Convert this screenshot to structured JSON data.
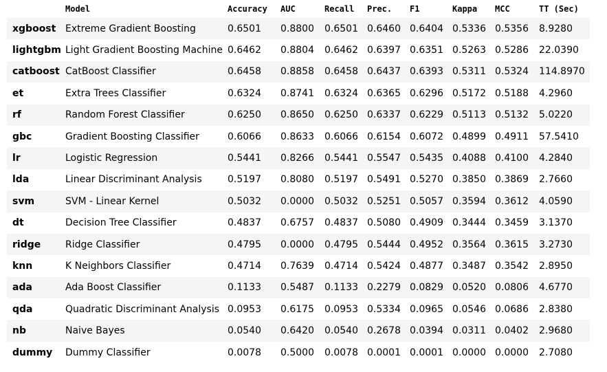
{
  "table": {
    "headers": [
      "",
      "Model",
      "Accuracy",
      "AUC",
      "Recall",
      "Prec.",
      "F1",
      "Kappa",
      "MCC",
      "TT (Sec)"
    ],
    "highlight_color": "#ffff00",
    "tt_column_color": "#d3d3d3",
    "stripe_color": "#f5f5f5",
    "rows": [
      {
        "id": "xgboost",
        "model": "Extreme Gradient Boosting",
        "values": [
          "0.6501",
          "0.8800",
          "0.6501",
          "0.6460",
          "0.6404",
          "0.5336",
          "0.5356",
          "8.9280"
        ],
        "highlighted": [
          "Accuracy",
          "Recall",
          "Prec.",
          "F1",
          "Kappa",
          "MCC"
        ]
      },
      {
        "id": "lightgbm",
        "model": "Light Gradient Boosting Machine",
        "values": [
          "0.6462",
          "0.8804",
          "0.6462",
          "0.6397",
          "0.6351",
          "0.5263",
          "0.5286",
          "22.0390"
        ],
        "highlighted": []
      },
      {
        "id": "catboost",
        "model": "CatBoost Classifier",
        "values": [
          "0.6458",
          "0.8858",
          "0.6458",
          "0.6437",
          "0.6393",
          "0.5311",
          "0.5324",
          "114.8970"
        ],
        "highlighted": [
          "AUC"
        ]
      },
      {
        "id": "et",
        "model": "Extra Trees Classifier",
        "values": [
          "0.6324",
          "0.8741",
          "0.6324",
          "0.6365",
          "0.6296",
          "0.5172",
          "0.5188",
          "4.2960"
        ],
        "highlighted": []
      },
      {
        "id": "rf",
        "model": "Random Forest Classifier",
        "values": [
          "0.6250",
          "0.8650",
          "0.6250",
          "0.6337",
          "0.6229",
          "0.5113",
          "0.5132",
          "5.0220"
        ],
        "highlighted": []
      },
      {
        "id": "gbc",
        "model": "Gradient Boosting Classifier",
        "values": [
          "0.6066",
          "0.8633",
          "0.6066",
          "0.6154",
          "0.6072",
          "0.4899",
          "0.4911",
          "57.5410"
        ],
        "highlighted": []
      },
      {
        "id": "lr",
        "model": "Logistic Regression",
        "values": [
          "0.5441",
          "0.8266",
          "0.5441",
          "0.5547",
          "0.5435",
          "0.4088",
          "0.4100",
          "4.2840"
        ],
        "highlighted": []
      },
      {
        "id": "lda",
        "model": "Linear Discriminant Analysis",
        "values": [
          "0.5197",
          "0.8080",
          "0.5197",
          "0.5491",
          "0.5270",
          "0.3850",
          "0.3869",
          "2.7660"
        ],
        "highlighted": []
      },
      {
        "id": "svm",
        "model": "SVM - Linear Kernel",
        "values": [
          "0.5032",
          "0.0000",
          "0.5032",
          "0.5251",
          "0.5057",
          "0.3594",
          "0.3612",
          "4.0590"
        ],
        "highlighted": []
      },
      {
        "id": "dt",
        "model": "Decision Tree Classifier",
        "values": [
          "0.4837",
          "0.6757",
          "0.4837",
          "0.5080",
          "0.4909",
          "0.3444",
          "0.3459",
          "3.1370"
        ],
        "highlighted": []
      },
      {
        "id": "ridge",
        "model": "Ridge Classifier",
        "values": [
          "0.4795",
          "0.0000",
          "0.4795",
          "0.5444",
          "0.4952",
          "0.3564",
          "0.3615",
          "3.2730"
        ],
        "highlighted": []
      },
      {
        "id": "knn",
        "model": "K Neighbors Classifier",
        "values": [
          "0.4714",
          "0.7639",
          "0.4714",
          "0.5424",
          "0.4877",
          "0.3487",
          "0.3542",
          "2.8950"
        ],
        "highlighted": []
      },
      {
        "id": "ada",
        "model": "Ada Boost Classifier",
        "values": [
          "0.1133",
          "0.5487",
          "0.1133",
          "0.2279",
          "0.0829",
          "0.0520",
          "0.0806",
          "4.6770"
        ],
        "highlighted": []
      },
      {
        "id": "qda",
        "model": "Quadratic Discriminant Analysis",
        "values": [
          "0.0953",
          "0.6175",
          "0.0953",
          "0.5334",
          "0.0965",
          "0.0546",
          "0.0686",
          "2.8380"
        ],
        "highlighted": []
      },
      {
        "id": "nb",
        "model": "Naive Bayes",
        "values": [
          "0.0540",
          "0.6420",
          "0.0540",
          "0.2678",
          "0.0394",
          "0.0311",
          "0.0402",
          "2.9680"
        ],
        "highlighted": []
      },
      {
        "id": "dummy",
        "model": "Dummy Classifier",
        "values": [
          "0.0078",
          "0.5000",
          "0.0078",
          "0.0001",
          "0.0001",
          "0.0000",
          "0.0000",
          "2.7080"
        ],
        "highlighted": []
      }
    ]
  }
}
